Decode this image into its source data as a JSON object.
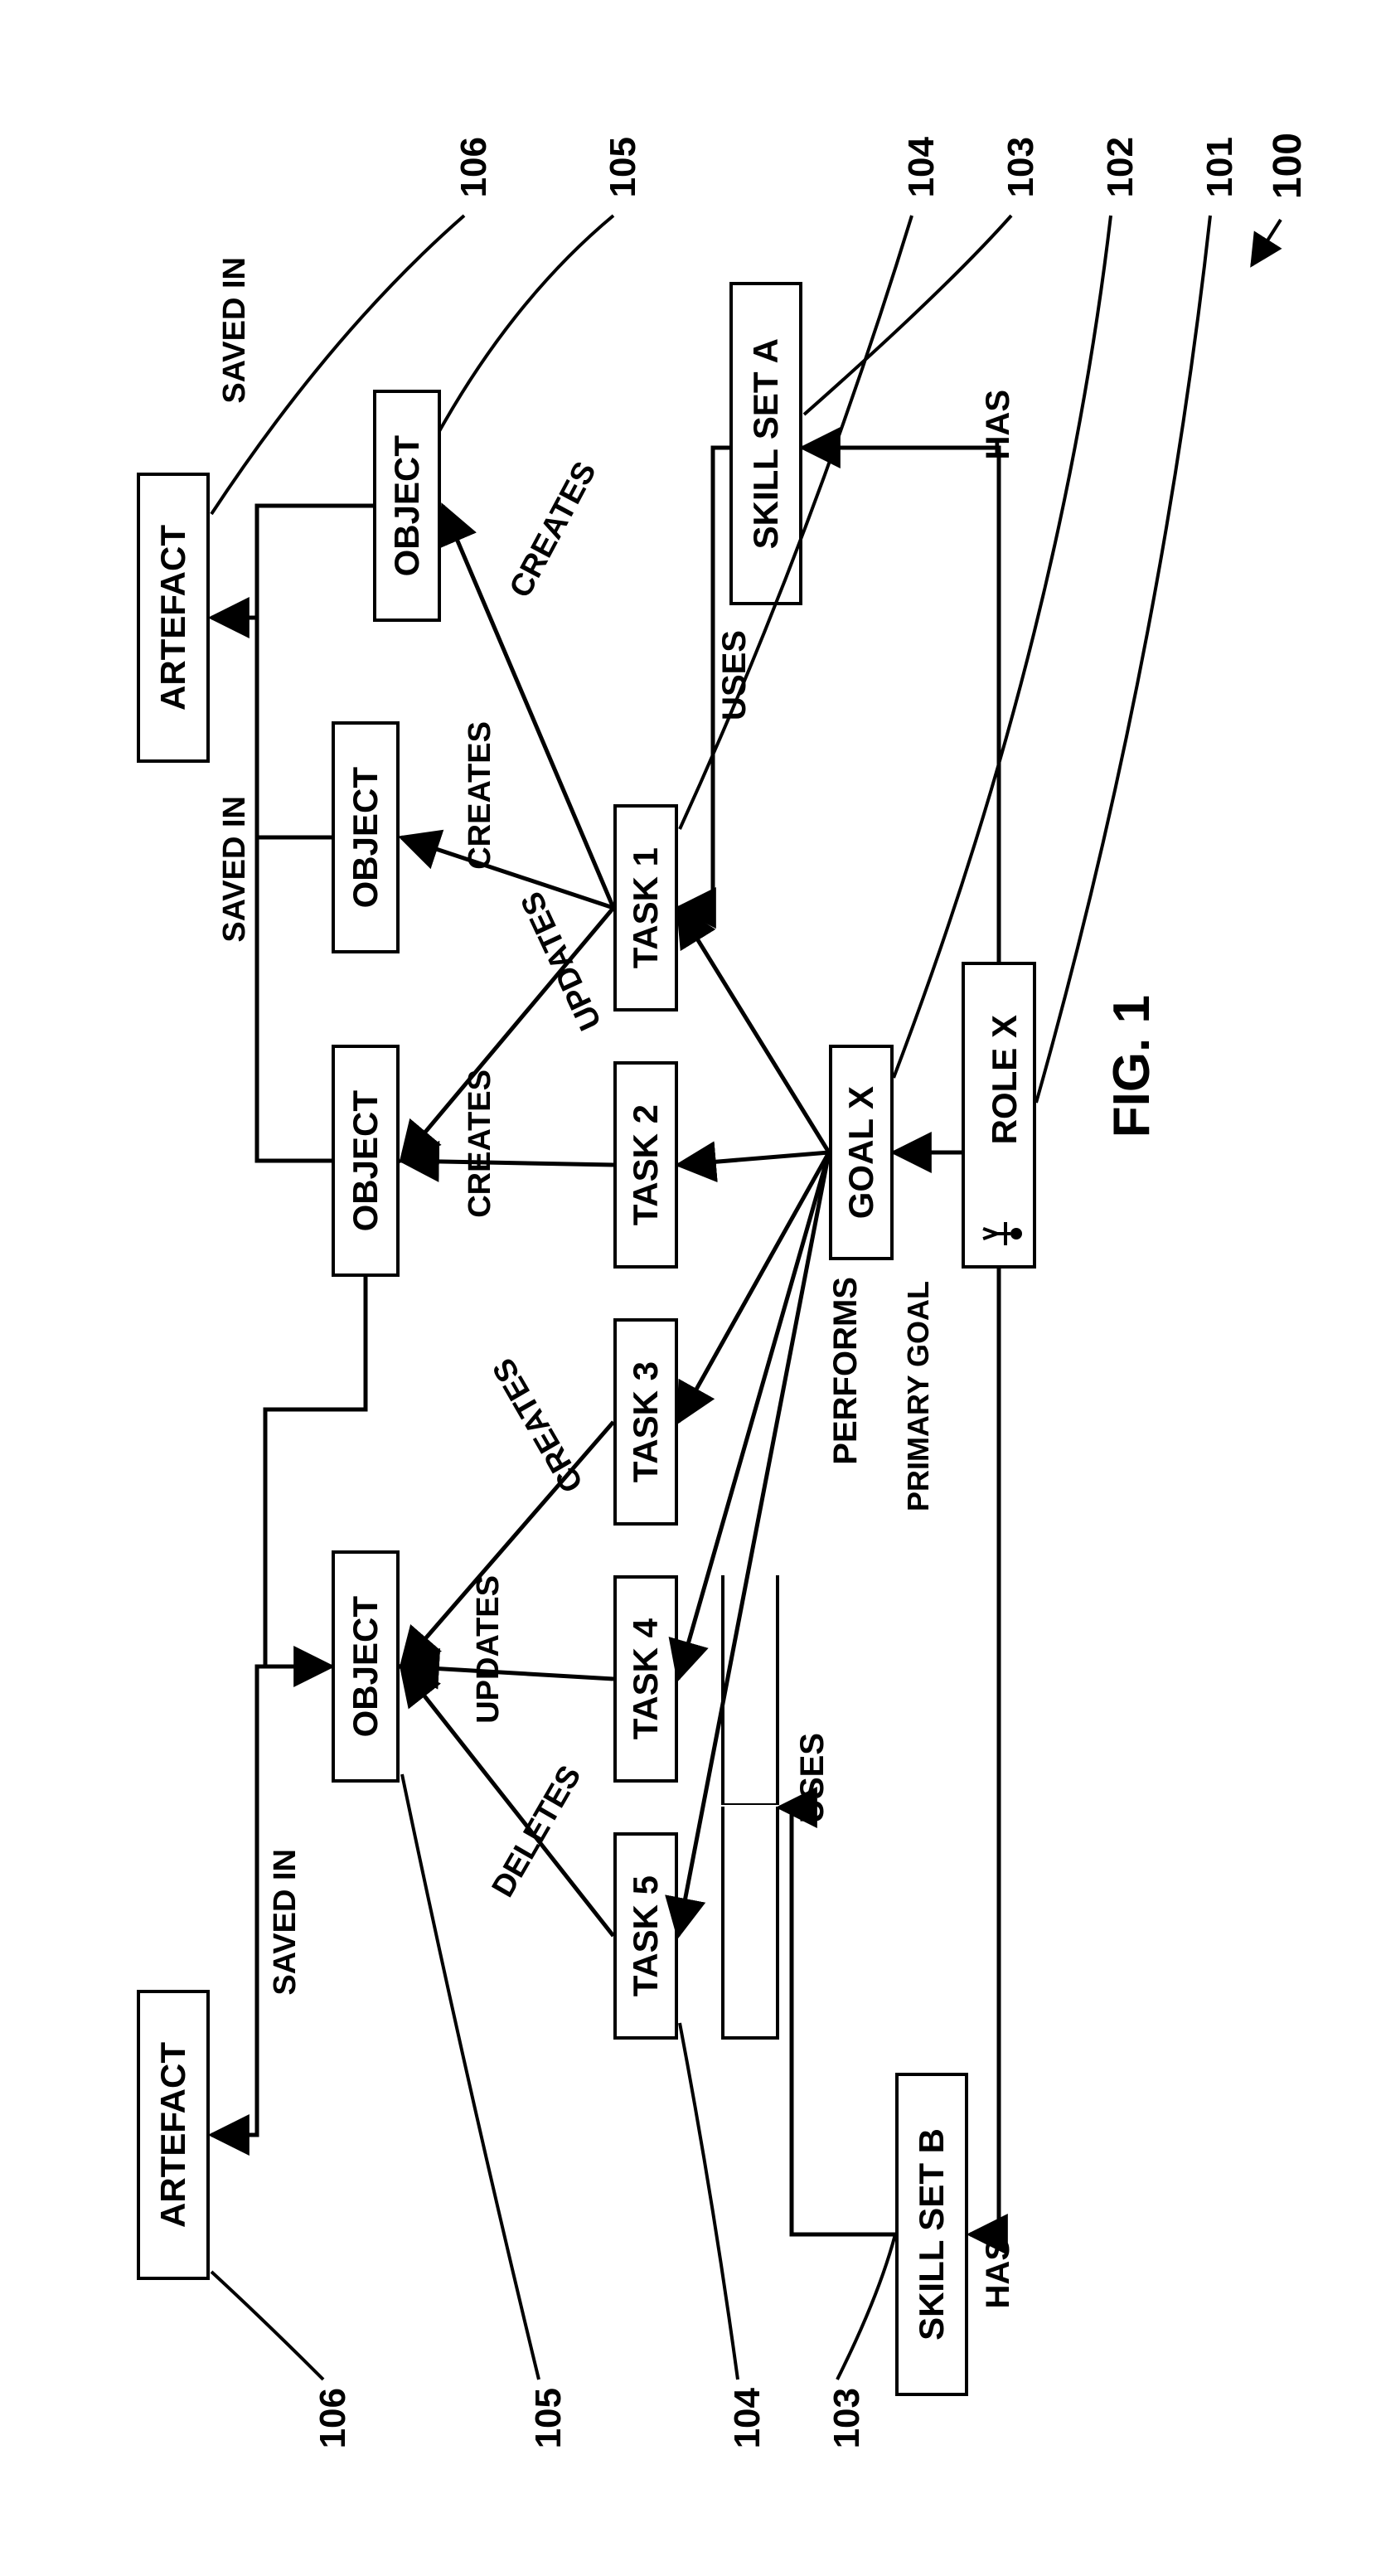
{
  "figure_title": "FIG. 1",
  "figure_ref": "100",
  "nodes": {
    "role": {
      "label": "ROLE X"
    },
    "goal": {
      "label": "GOAL X"
    },
    "skillA": {
      "label": "SKILL SET A"
    },
    "skillB": {
      "label": "SKILL SET B"
    },
    "task1": {
      "label": "TASK 1"
    },
    "task2": {
      "label": "TASK 2"
    },
    "task3": {
      "label": "TASK 3"
    },
    "task4": {
      "label": "TASK 4"
    },
    "task5": {
      "label": "TASK 5"
    },
    "object_a": {
      "label": "OBJECT"
    },
    "object_b": {
      "label": "OBJECT"
    },
    "object_c": {
      "label": "OBJECT"
    },
    "object_d": {
      "label": "OBJECT"
    },
    "artefact_l": {
      "label": "ARTEFACT"
    },
    "artefact_r": {
      "label": "ARTEFACT"
    }
  },
  "edges": {
    "has_a": "HAS",
    "has_b": "HAS",
    "primary_goal": "PRIMARY GOAL",
    "performs": "PERFORMS",
    "uses_a": "USES",
    "uses_b": "USES",
    "creates_1a": "CREATES",
    "creates_1b": "CREATES",
    "updates_1c": "UPDATES",
    "creates_2c": "CREATES",
    "creates_3d": "CREATES",
    "updates_4d": "UPDATES",
    "deletes_5d": "DELETES",
    "saved_in_a": "SAVED IN",
    "saved_in_bc": "SAVED IN",
    "saved_in_d": "SAVED IN"
  },
  "refs": {
    "r101": "101",
    "r102": "102",
    "r103": "103",
    "r103b": "103",
    "r104": "104",
    "r104b": "104",
    "r105": "105",
    "r105b": "105",
    "r106": "106",
    "r106b": "106"
  }
}
